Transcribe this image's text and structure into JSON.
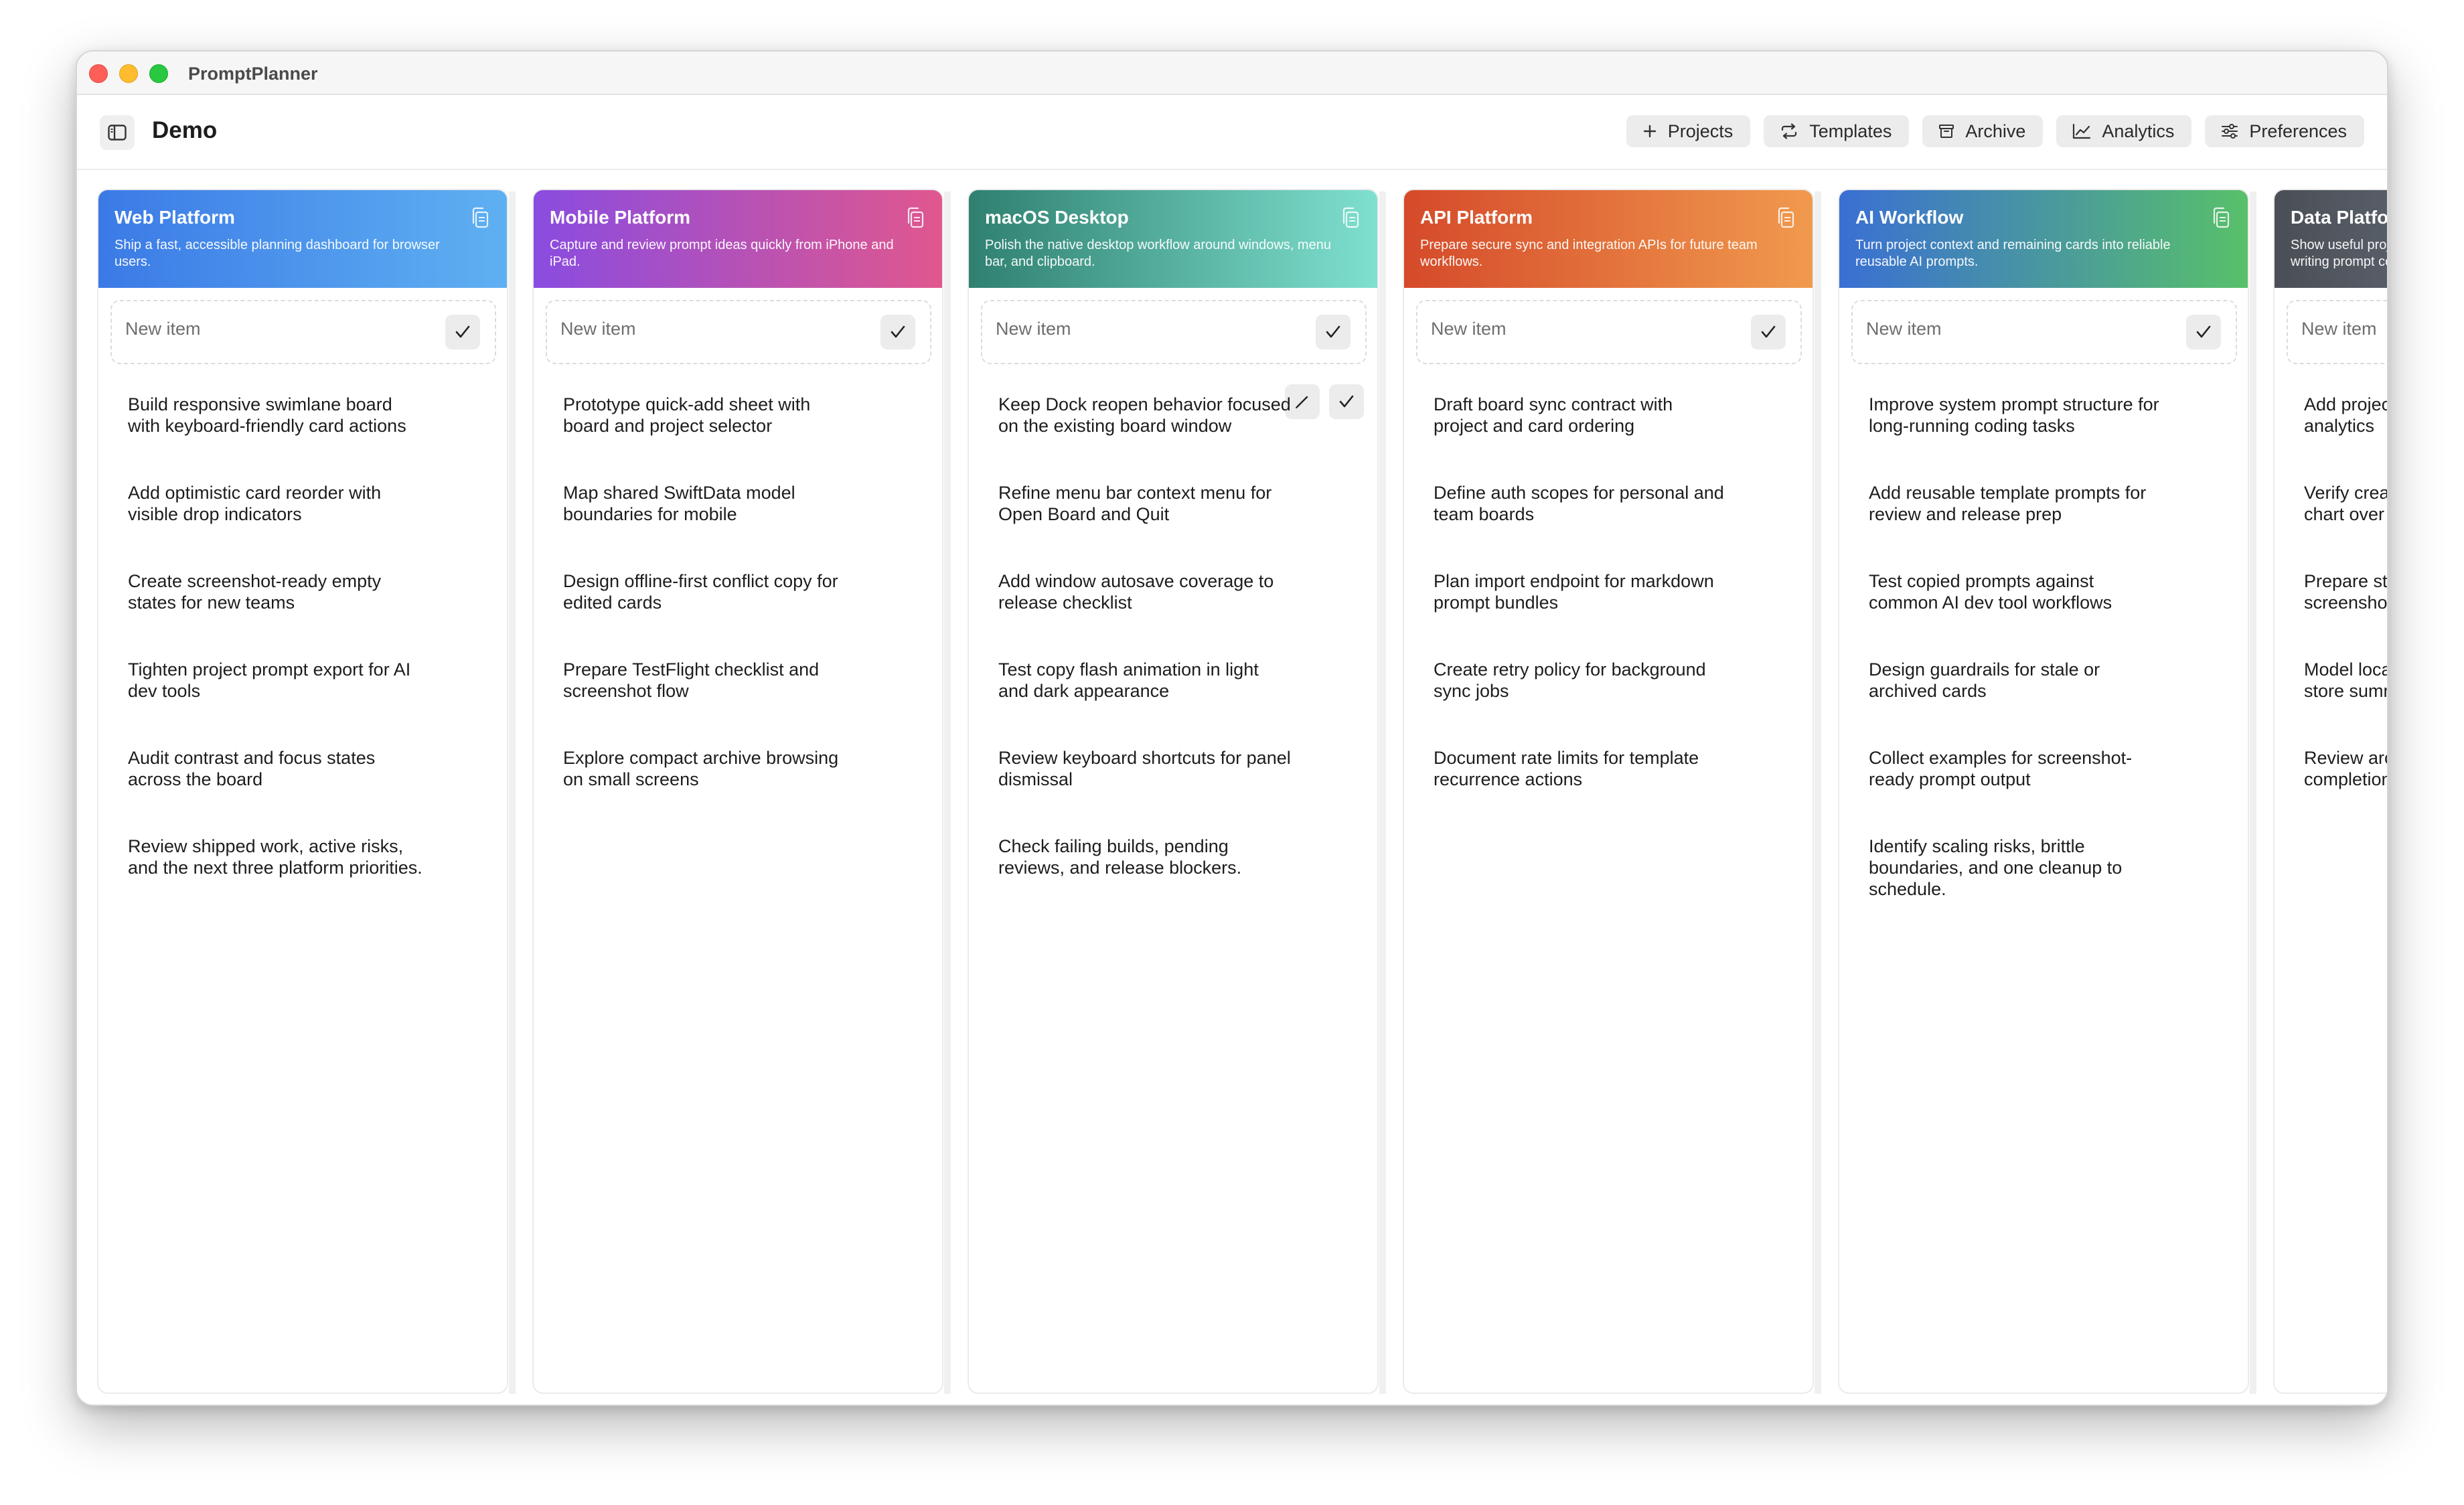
{
  "app": {
    "title": "PromptPlanner"
  },
  "toolbar": {
    "board_title": "Demo",
    "buttons": [
      {
        "label": "Projects",
        "icon": "plus-icon"
      },
      {
        "label": "Templates",
        "icon": "repeat-icon"
      },
      {
        "label": "Archive",
        "icon": "archive-box-icon"
      },
      {
        "label": "Analytics",
        "icon": "chart-line-icon"
      },
      {
        "label": "Preferences",
        "icon": "sliders-icon"
      }
    ]
  },
  "columns": [
    {
      "name": "Web Platform",
      "description": "Ship a fast, accessible planning dashboard for browser users.",
      "gradient": [
        "#3b7ae6",
        "#5fb0f2"
      ],
      "new_item_placeholder": "New item",
      "items": [
        "Build responsive swimlane board with keyboard-friendly card actions",
        "Add optimistic card reorder with visible drop indicators",
        "Create screenshot-ready empty states for new teams",
        "Tighten project prompt export for AI dev tools",
        "Audit contrast and focus states across the board",
        "Review shipped work, active risks, and the next three platform priorities."
      ]
    },
    {
      "name": "Mobile Platform",
      "description": "Capture and review prompt ideas quickly from iPhone and iPad.",
      "gradient": [
        "#8a4ce0",
        "#e0578e"
      ],
      "new_item_placeholder": "New item",
      "items": [
        "Prototype quick-add sheet with board and project selector",
        "Map shared SwiftData model boundaries for mobile",
        "Design offline-first conflict copy for edited cards",
        "Prepare TestFlight checklist and screenshot flow",
        "Explore compact archive browsing on small screens"
      ]
    },
    {
      "name": "macOS Desktop",
      "description": "Polish the native desktop workflow around windows, menu bar, and clipboard.",
      "gradient": [
        "#2f8070",
        "#7fe0cf"
      ],
      "new_item_placeholder": "New item",
      "items": [
        "Keep Dock reopen behavior focused on the existing board window",
        "Refine menu bar context menu for Open Board and Quit",
        "Add window autosave coverage to release checklist",
        "Test copy flash animation in light and dark appearance",
        "Review keyboard shortcuts for panel dismissal",
        "Check failing builds, pending reviews, and release blockers."
      ]
    },
    {
      "name": "API Platform",
      "description": "Prepare secure sync and integration APIs for future team workflows.",
      "gradient": [
        "#d54a2a",
        "#f09a4e"
      ],
      "new_item_placeholder": "New item",
      "items": [
        "Draft board sync contract with project and card ordering",
        "Define auth scopes for personal and team boards",
        "Plan import endpoint for markdown prompt bundles",
        "Create retry policy for background sync jobs",
        "Document rate limits for template recurrence actions"
      ]
    },
    {
      "name": "AI Workflow",
      "description": "Turn project context and remaining cards into reliable reusable AI prompts.",
      "gradient": [
        "#3a6fd4",
        "#58c06a"
      ],
      "new_item_placeholder": "New item",
      "items": [
        "Improve system prompt structure for long-running coding tasks",
        "Add reusable template prompts for review and release prep",
        "Test copied prompts against common AI dev tool workflows",
        "Design guardrails for stale or archived cards",
        "Collect examples for screenshot-ready prompt output",
        "Identify scaling risks, brittle boundaries, and one cleanup to schedule."
      ]
    },
    {
      "name": "Data Platform",
      "description": "Show useful project metrics without getting in the way of writing prompt content.",
      "gradient": [
        "#4a4f57",
        "#7a838e"
      ],
      "new_item_placeholder": "New item",
      "items": [
        "Add project completion trends for analytics",
        "Verify created versus completed chart over time",
        "Prepare starter data for App Store screenshots",
        "Model local metrics snapshots for store summaries",
        "Review archive queries for bulk completion"
      ]
    }
  ],
  "hovered_card_actions": [
    "edit-icon",
    "check-icon"
  ]
}
